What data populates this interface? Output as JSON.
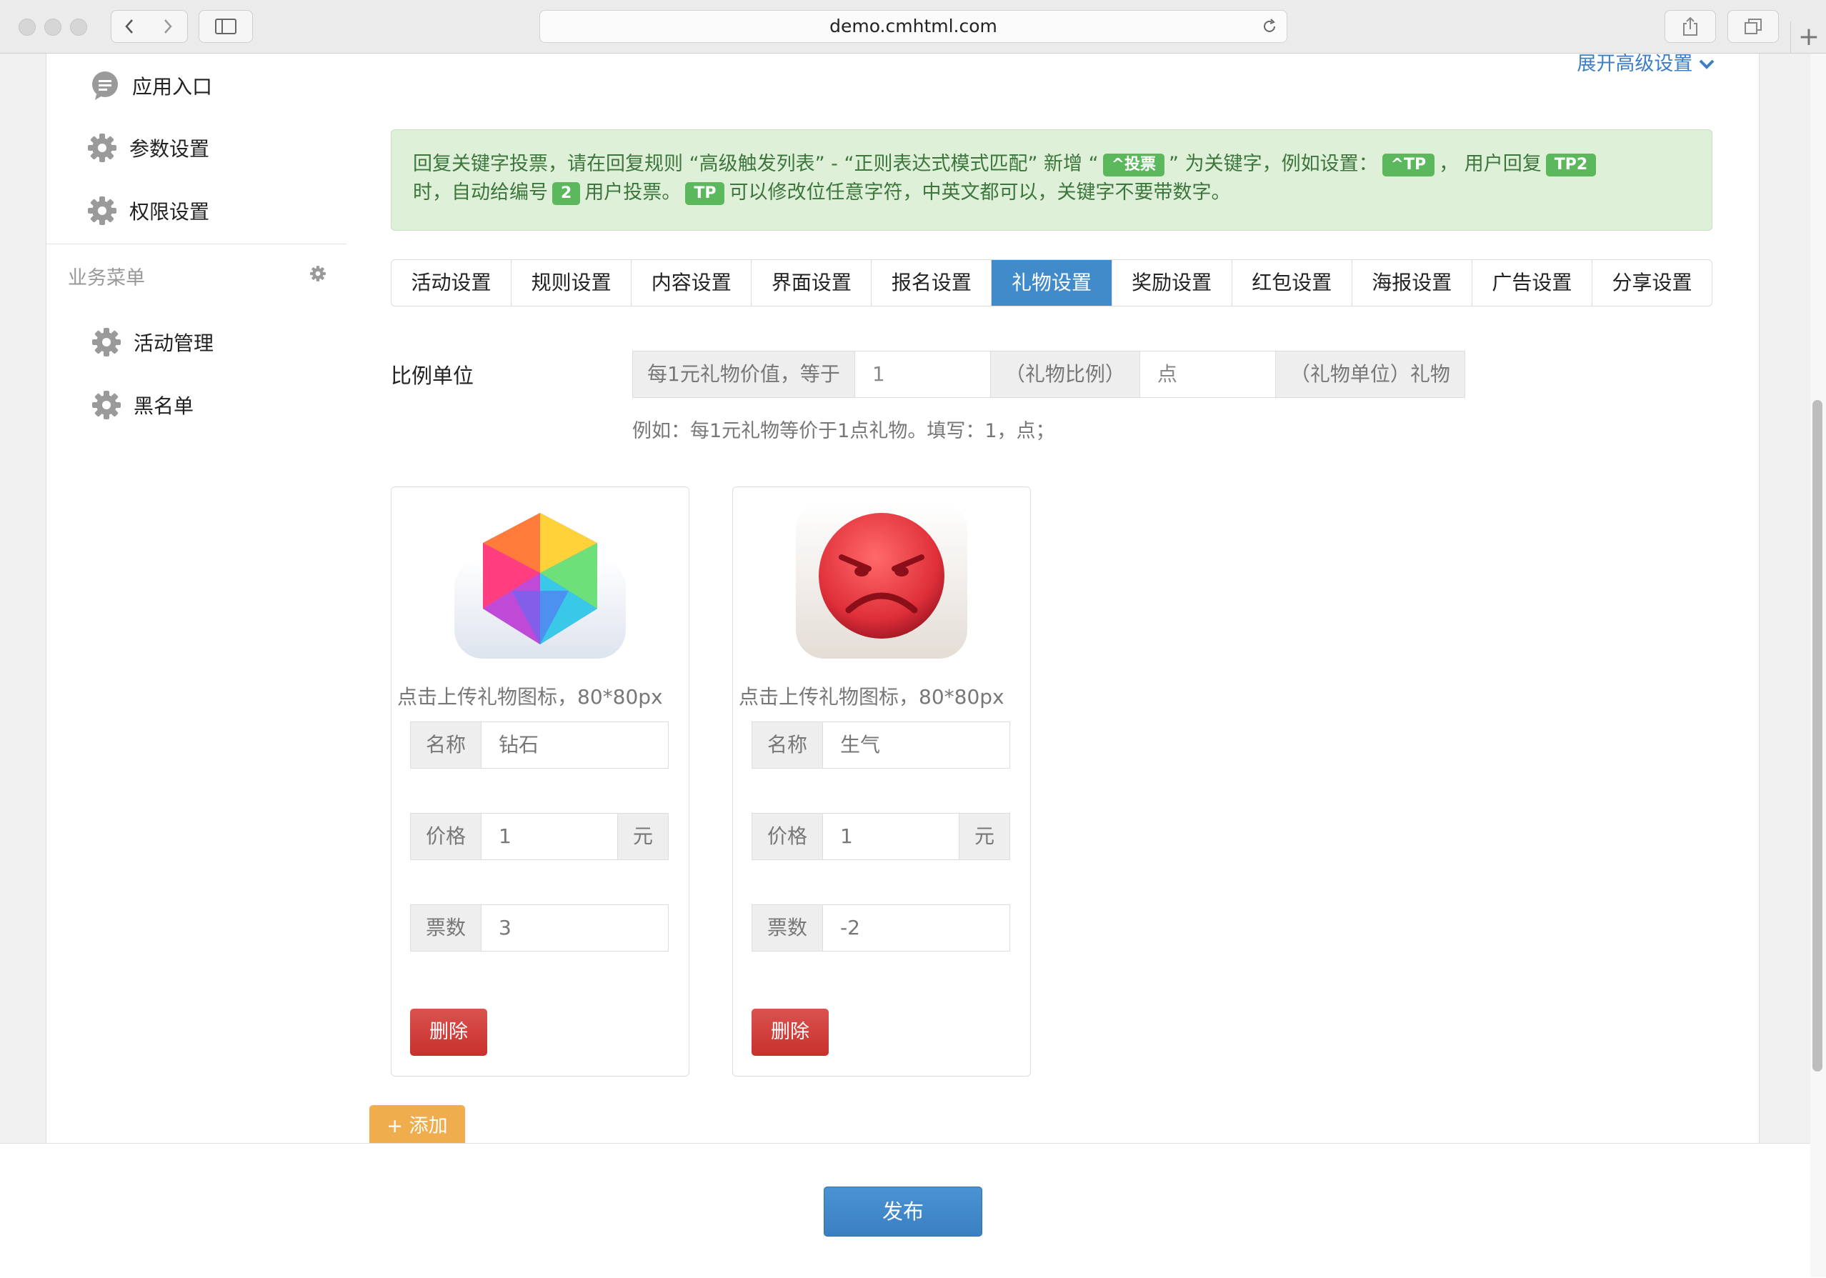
{
  "browser": {
    "url": "demo.cmhtml.com"
  },
  "sidebar": {
    "items": [
      {
        "label": "应用入口",
        "icon": "chat-bubble-icon"
      },
      {
        "label": "参数设置",
        "icon": "gear-icon"
      },
      {
        "label": "权限设置",
        "icon": "gear-icon"
      }
    ],
    "section_title": "业务菜单",
    "section_items": [
      {
        "label": "活动管理",
        "icon": "gear-icon"
      },
      {
        "label": "黑名单",
        "icon": "gear-icon"
      }
    ]
  },
  "main": {
    "expand_label": "展开高级设置",
    "notice": {
      "p1": "回复关键字投票，请在回复规则 “高级触发列表” - “正则表达式模式匹配” 新增 “",
      "label1": "^投票",
      "p2": "” 为关键字，例如设置：",
      "label2": "^TP",
      "p3": "， 用户回复",
      "label3": "TP2",
      "p4": "时，自动给编号",
      "label4": "2",
      "p5": "用户投票。",
      "label5": "TP",
      "p6": "可以修改位任意字符，中英文都可以，关键字不要带数字。"
    },
    "tabs": [
      "活动设置",
      "规则设置",
      "内容设置",
      "界面设置",
      "报名设置",
      "礼物设置",
      "奖励设置",
      "红包设置",
      "海报设置",
      "广告设置",
      "分享设置"
    ],
    "active_tab": "礼物设置",
    "ratio": {
      "label": "比例单位",
      "prefix": "每1元礼物价值，等于",
      "value": "1",
      "middle": "（礼物比例）",
      "unit": "点",
      "suffix": "（礼物单位）礼物",
      "help": "例如：每1元礼物等价于1点礼物。填写：1，点；"
    },
    "gifts": [
      {
        "icon": "diamond-gem-icon",
        "upload_hint": "点击上传礼物图标，80*80px",
        "name_label": "名称",
        "name": "钻石",
        "price_label": "价格",
        "price": "1",
        "price_unit": "元",
        "votes_label": "票数",
        "votes": "3",
        "delete_label": "删除"
      },
      {
        "icon": "angry-face-icon",
        "upload_hint": "点击上传礼物图标，80*80px",
        "name_label": "名称",
        "name": "生气",
        "price_label": "价格",
        "price": "1",
        "price_unit": "元",
        "votes_label": "票数",
        "votes": "-2",
        "delete_label": "删除"
      }
    ],
    "add_label": "+ 添加"
  },
  "footer": {
    "publish_label": "发布"
  },
  "colors": {
    "primary": "#428bca",
    "success_bg": "#dff0d8",
    "success_text": "#3c763d",
    "label_green": "#5cb85c",
    "danger": "#c9302c",
    "warning": "#f0ad4e"
  }
}
